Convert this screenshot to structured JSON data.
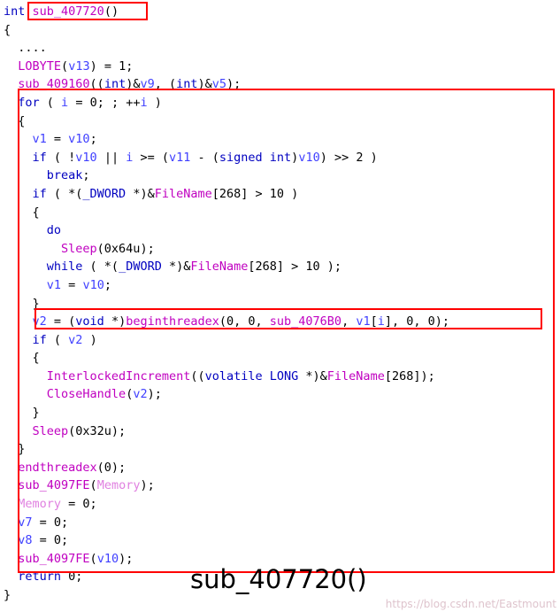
{
  "document": {
    "type": "decompiled-c-code-listing",
    "caption": "sub_407720()",
    "watermark": "https://blog.csdn.net/Eastmount",
    "annotations": [
      {
        "name": "title-highlight",
        "target": "sub_407720()"
      },
      {
        "name": "main-loop-highlight",
        "target": "for-loop body block"
      },
      {
        "name": "beginthreadex-highlight",
        "target": "v2 = (void *)beginthreadex(0, 0, sub_4076B0, v1[i], 0, 0);"
      }
    ],
    "colors": {
      "keyword": "#0000c0",
      "function": "#c000c0",
      "variable": "#4040ff",
      "annotation": "#ff0000",
      "background": "#ffffff",
      "text": "#000000"
    },
    "code_lines": [
      "int sub_407720()",
      "{",
      "  ....",
      "  LOBYTE(v13) = 1;",
      "  sub_409160((int)&v9, (int)&v5);",
      "  for ( i = 0; ; ++i )",
      "  {",
      "    v1 = v10;",
      "    if ( !v10 || i >= (v11 - (signed int)v10) >> 2 )",
      "      break;",
      "    if ( *(_DWORD *)&FileName[268] > 10 )",
      "    {",
      "      do",
      "        Sleep(0x64u);",
      "      while ( *(_DWORD *)&FileName[268] > 10 );",
      "      v1 = v10;",
      "    }",
      "    v2 = (void *)beginthreadex(0, 0, sub_4076B0, v1[i], 0, 0);",
      "    if ( v2 )",
      "    {",
      "      InterlockedIncrement((volatile LONG *)&FileName[268]);",
      "      CloseHandle(v2);",
      "    }",
      "    Sleep(0x32u);",
      "  }",
      "  endthreadex(0);",
      "  sub_4097FE(Memory);",
      "  Memory = 0;",
      "  v7 = 0;",
      "  v8 = 0;",
      "  sub_4097FE(v10);",
      "  return 0;",
      "}"
    ]
  }
}
